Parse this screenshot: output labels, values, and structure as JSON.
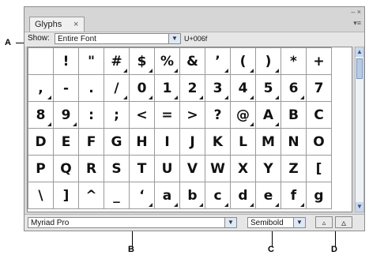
{
  "callouts": {
    "a": "A",
    "b": "B",
    "c": "C",
    "d": "D"
  },
  "panel": {
    "tab_label": "Glyphs",
    "tab_close": "×",
    "panel_controls": "– ×",
    "menu_icon": "▾≡"
  },
  "show": {
    "label": "Show:",
    "selected": "Entire Font",
    "unicode": "U+006f"
  },
  "glyphs": [
    [
      "",
      "!",
      "\"",
      "#",
      "$",
      "%",
      "&",
      "’",
      "(",
      ")",
      "*",
      "+"
    ],
    [
      ",",
      "-",
      ".",
      "/",
      "0",
      "1",
      "2",
      "3",
      "4",
      "5",
      "6",
      "7"
    ],
    [
      "8",
      "9",
      ":",
      ";",
      "<",
      "=",
      ">",
      "?",
      "@",
      "A",
      "B",
      "C"
    ],
    [
      "D",
      "E",
      "F",
      "G",
      "H",
      "I",
      "J",
      "K",
      "L",
      "M",
      "N",
      "O"
    ],
    [
      "P",
      "Q",
      "R",
      "S",
      "T",
      "U",
      "V",
      "W",
      "X",
      "Y",
      "Z",
      "["
    ],
    [
      "\\",
      "]",
      "^",
      "_",
      "‘",
      "a",
      "b",
      "c",
      "d",
      "e",
      "f",
      "g"
    ]
  ],
  "bottom": {
    "font": "Myriad Pro",
    "style": "Semibold",
    "zoom_out_icon": "▵",
    "zoom_in_icon": "▵"
  }
}
